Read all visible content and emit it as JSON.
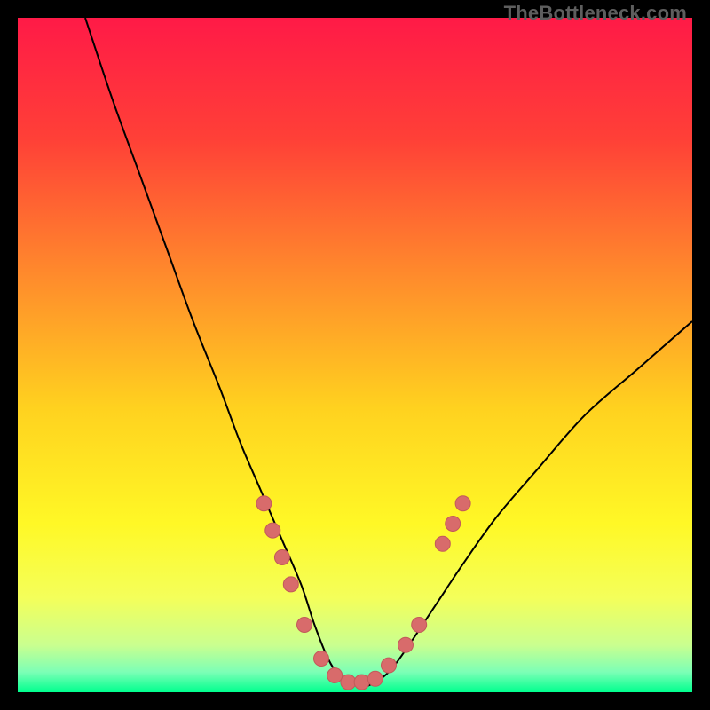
{
  "watermark": "TheBottleneck.com",
  "colors": {
    "marker": "#d86b6b",
    "marker_stroke": "#c25a5a",
    "curve": "#000000"
  },
  "chart_data": {
    "type": "line",
    "title": "",
    "xlabel": "",
    "ylabel": "",
    "xlim": [
      0,
      100
    ],
    "ylim": [
      0,
      100
    ],
    "gradient_stops": [
      {
        "offset": 0.0,
        "color": "#ff1a47"
      },
      {
        "offset": 0.18,
        "color": "#ff4037"
      },
      {
        "offset": 0.38,
        "color": "#ff8a2c"
      },
      {
        "offset": 0.58,
        "color": "#ffd21f"
      },
      {
        "offset": 0.75,
        "color": "#fff826"
      },
      {
        "offset": 0.86,
        "color": "#f4ff5a"
      },
      {
        "offset": 0.93,
        "color": "#caff8f"
      },
      {
        "offset": 0.97,
        "color": "#7cffb6"
      },
      {
        "offset": 1.0,
        "color": "#00ff8e"
      }
    ],
    "series": [
      {
        "name": "bottleneck-curve",
        "x": [
          10,
          14,
          18,
          22,
          26,
          30,
          33,
          36,
          39,
          42,
          44,
          46,
          48,
          50,
          52,
          55,
          58,
          62,
          66,
          71,
          77,
          84,
          92,
          100
        ],
        "values": [
          100,
          88,
          77,
          66,
          55,
          45,
          37,
          30,
          23,
          16,
          10,
          5,
          2,
          1,
          1,
          3,
          7,
          13,
          19,
          26,
          33,
          41,
          48,
          55
        ]
      }
    ],
    "markers": [
      {
        "x": 36.5,
        "y": 28
      },
      {
        "x": 37.8,
        "y": 24
      },
      {
        "x": 39.2,
        "y": 20
      },
      {
        "x": 40.5,
        "y": 16
      },
      {
        "x": 42.5,
        "y": 10
      },
      {
        "x": 45.0,
        "y": 5
      },
      {
        "x": 47.0,
        "y": 2.5
      },
      {
        "x": 49.0,
        "y": 1.5
      },
      {
        "x": 51.0,
        "y": 1.5
      },
      {
        "x": 53.0,
        "y": 2
      },
      {
        "x": 55.0,
        "y": 4
      },
      {
        "x": 57.5,
        "y": 7
      },
      {
        "x": 59.5,
        "y": 10
      },
      {
        "x": 63.0,
        "y": 22
      },
      {
        "x": 64.5,
        "y": 25
      },
      {
        "x": 66.0,
        "y": 28
      }
    ]
  }
}
